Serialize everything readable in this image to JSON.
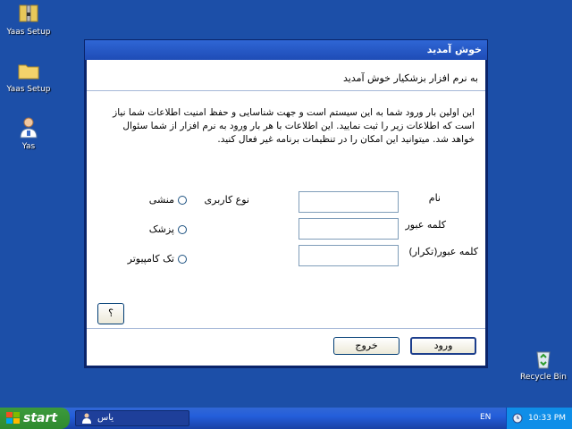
{
  "desktop": {
    "icons": [
      {
        "label": "Yaas Setup",
        "icon": "zip-folder-icon"
      },
      {
        "label": "Yaas Setup",
        "icon": "folder-icon"
      },
      {
        "label": "Yas",
        "icon": "doctor-user-icon"
      },
      {
        "label": "Recycle Bin",
        "icon": "recycle-bin-icon"
      }
    ]
  },
  "dialog": {
    "title": "خوش آمدید",
    "welcome": "به نرم افزار بزشکیار خوش آمدید",
    "intro": "این اولین بار ورود شما به این سیستم است و جهت شناسایی و حفظ امنیت اطلاعات شما نیاز است که اطلاعات زیر را ثبت نمایید. این اطلاعات با هر بار ورود به نرم افزار از شما سئوال خواهد شد. میتوانید این امکان را در تنظیمات برنامه غیر فعال کنید.",
    "fields": {
      "name_label": "نام",
      "password_label": "کلمه عبور",
      "password_repeat_label": "کلمه عبور(تکرار)",
      "name_value": "",
      "password_value": "",
      "password_repeat_value": ""
    },
    "user_type": {
      "label": "نوع کاربری",
      "options": [
        "منشی",
        "پزشک",
        "تک کامپیوتر"
      ]
    },
    "help_button": "؟",
    "login_button": "ورود",
    "exit_button": "خروج"
  },
  "taskbar": {
    "start_label": "start",
    "task_label": "یاس",
    "language": "EN",
    "clock": "10:33 PM"
  },
  "colors": {
    "desktop": "#1c4fa8",
    "titlebar": "#2f66d5",
    "start": "#3c9a3c"
  }
}
